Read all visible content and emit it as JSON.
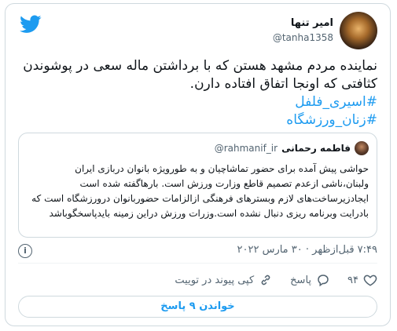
{
  "header": {
    "display_name": "امیر تنها",
    "handle": "@tanha1358"
  },
  "tweet": {
    "text": "نماینده مردم مشهد هستن که با برداشتن ماله سعی در پوشوندن کثافتی که اونجا اتفاق افتاده دارن.",
    "hashtags": [
      "#اسیری_فلفل",
      "#زنان_ورزشگاه"
    ]
  },
  "quote": {
    "display_name": "فاطمه رحمانی",
    "handle": "@rahmanif_ir",
    "text": "حواشی پیش آمده برای حضور تماشاچیان و به طورویژه بانوان دربازی ایران ولبنان،ناشی ازعدم تصمیم قاطع وزارت ورزش است. بارهاگفته شده است ایجادزیرساخت‌های لازم وبسترهای فرهنگی ازالزامات حضوربانوان درورزشگاه است که بادرایت وبرنامه ریزی دنبال نشده است.وزرات ورزش دراین زمینه بایدپاسخگوباشد"
  },
  "meta": {
    "timestamp": "۷:۴۹ قبل‌ازظهر · ۳۰ مارس ۲۰۲۲",
    "info_symbol": "i"
  },
  "actions": {
    "like_count": "۹۴",
    "reply_label": "پاسخ",
    "copy_link_label": "کپی پیوند در توییت"
  },
  "replies_button": {
    "label": "خواندن ۹ پاسخ"
  },
  "colors": {
    "accent": "#1d9bf0",
    "muted": "#536471",
    "border": "#cfd9de"
  }
}
